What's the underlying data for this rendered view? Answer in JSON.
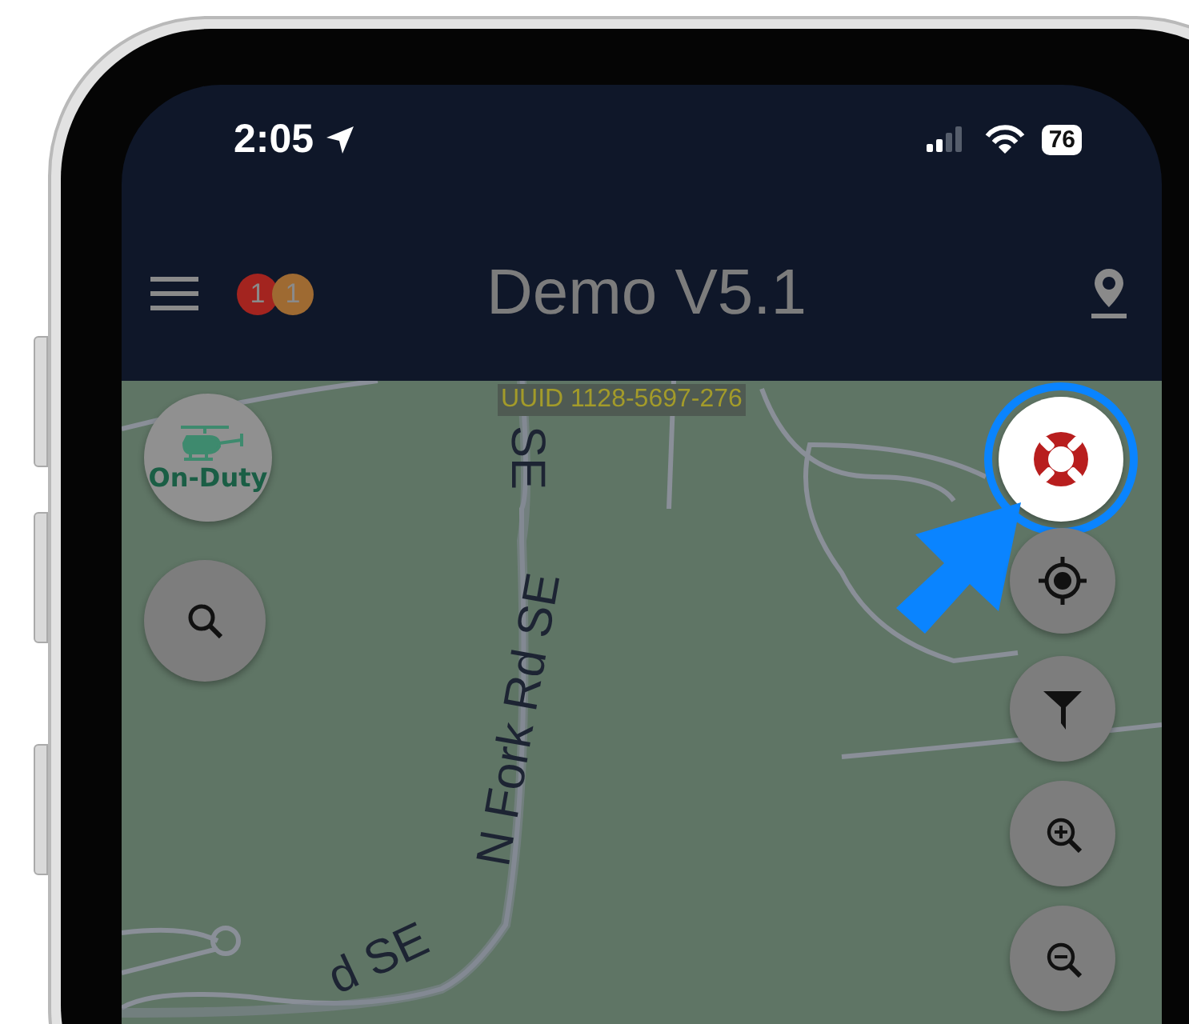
{
  "status_bar": {
    "time": "2:05",
    "battery": "76"
  },
  "app_bar": {
    "title": "Demo V5.1",
    "badges": [
      {
        "count": "1",
        "color": "#a3241f"
      },
      {
        "count": "1",
        "color": "#9e6a32"
      }
    ]
  },
  "map": {
    "uuid_label": "UUID 1128-5697-276",
    "road_labels": [
      "SE",
      "N Fork Rd SE",
      "d SE"
    ],
    "duty_button": {
      "label": "On-Duty"
    },
    "buttons": [
      {
        "kind": "help",
        "highlighted": true
      },
      {
        "kind": "locate",
        "highlighted": false
      },
      {
        "kind": "filter",
        "highlighted": false
      },
      {
        "kind": "zoom_in",
        "highlighted": false
      },
      {
        "kind": "zoom_out",
        "highlighted": false
      }
    ]
  }
}
